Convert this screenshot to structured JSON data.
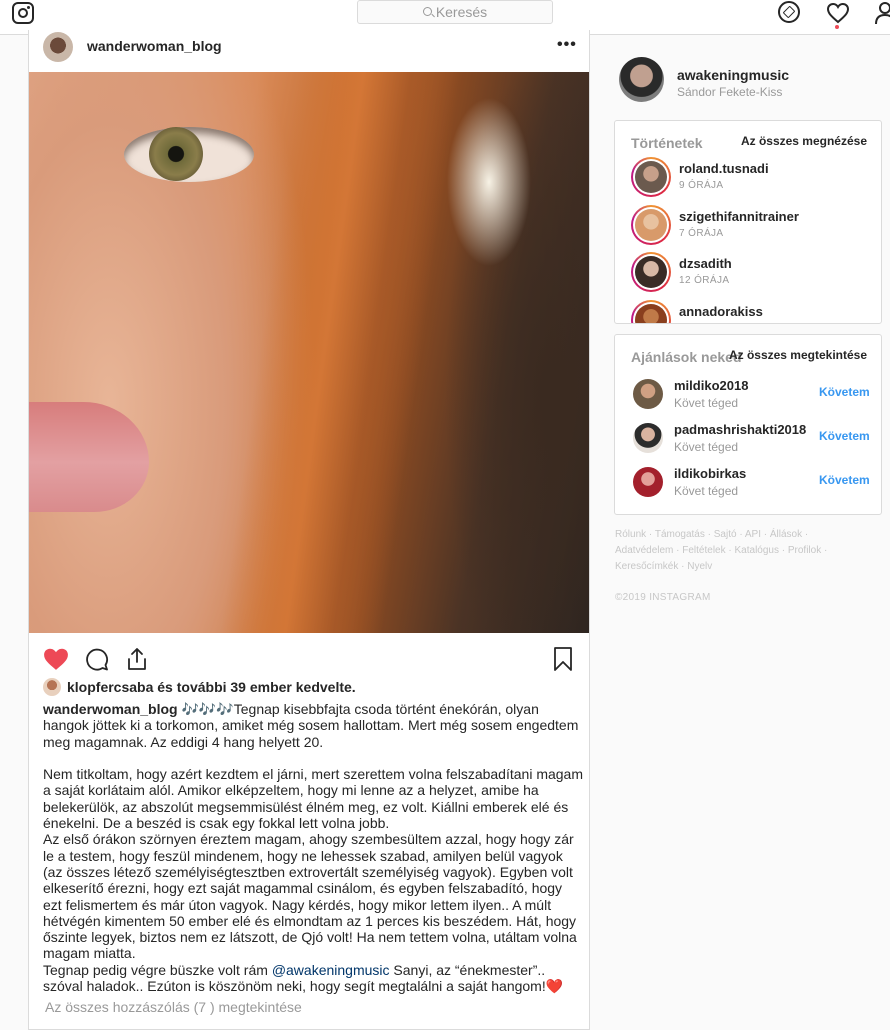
{
  "nav": {
    "search_placeholder": "Keresés",
    "icons": [
      "instagram-logo-icon",
      "search-icon",
      "compass-icon",
      "heart-icon",
      "person-icon"
    ],
    "notification_dot_color": "#ed4956"
  },
  "post": {
    "username": "wanderwoman_blog",
    "more": "•••",
    "likes": {
      "user": "klopfercsaba",
      "text": " és további 39 ember kedvelte."
    },
    "caption": {
      "user": "wanderwoman_blog",
      "text_1": " 🎶🎶🎶Tegnap kisebbfajta csoda történt énekórán, olyan hangok jöttek ki a torkomon, amiket még sosem hallottam. Mert még sosem engedtem meg magamnak. Az eddigi 4 hang helyett 20.\n\nNem titkoltam, hogy azért kezdtem el járni, mert szerettem volna felszabadítani magam a saját korlátaim alól. Amikor elképzeltem, hogy mi lenne az a helyzet, amibe ha belekerülök, az abszolút megsemmisülést élném meg, ez volt. Kiállni emberek elé és énekelni. De a beszéd is csak egy fokkal lett volna jobb.\nAz első órákon szörnyen éreztem magam, ahogy szembesültem azzal, hogy hogy zár le a testem, hogy feszül mindenem, hogy ne lehessek szabad, amilyen belül vagyok (az összes létező személyiségtesztben extrovertált személyiség vagyok). Egyben volt elkeserítő érezni, hogy ezt saját magammal csinálom, és egyben felszabadító, hogy ezt felismertem és már úton vagyok. Nagy kérdés, hogy mikor lettem ilyen.. A múlt hétvégén kimentem 50 ember elé és elmondtam az 1 perces kis beszédem. Hát, hogy őszinte legyek, biztos nem ez látszott, de Qjó volt! Ha nem tettem volna, utáltam volna magam miatta.\nTegnap pedig végre büszke volt rám ",
      "mention": "@awakeningmusic",
      "text_2": " Sanyi, az “énekmester”.. szóval haladok.. Ezúton is köszönöm neki, hogy segít megtalálni a saját hangom!❤️"
    },
    "view_comments": "Az összes hozzászólás (7 ) megtekintése",
    "liked": true,
    "like_color": "#ed4956"
  },
  "sidebar": {
    "me": {
      "username": "awakeningmusic",
      "full_name": "Sándor Fekete-Kiss"
    },
    "stories": {
      "title": "Történetek",
      "see_all": "Az összes megnézése",
      "items": [
        {
          "name": "roland.tusnadi",
          "time": "9 ÓRÁJA"
        },
        {
          "name": "szigethifannitrainer",
          "time": "7 ÓRÁJA"
        },
        {
          "name": "dzsadith",
          "time": "12 ÓRÁJA"
        },
        {
          "name": "annadorakiss",
          "time": ""
        }
      ]
    },
    "suggestions": {
      "title": "Ajánlások neked",
      "see_all": "Az összes megtekintése",
      "items": [
        {
          "name": "mildiko2018",
          "sub": "Követ téged",
          "action": "Követem"
        },
        {
          "name": "padmashrishakti2018",
          "sub": "Követ téged",
          "action": "Követem"
        },
        {
          "name": "ildikobirkas",
          "sub": "Követ téged",
          "action": "Követem"
        }
      ]
    },
    "footer_links": "Rólunk · Támogatás · Sajtó · API · Állások · Adatvédelem · Feltételek · Katalógus · Profilok · Keresőcímkék · Nyelv",
    "copyright": "©2019 INSTAGRAM"
  }
}
